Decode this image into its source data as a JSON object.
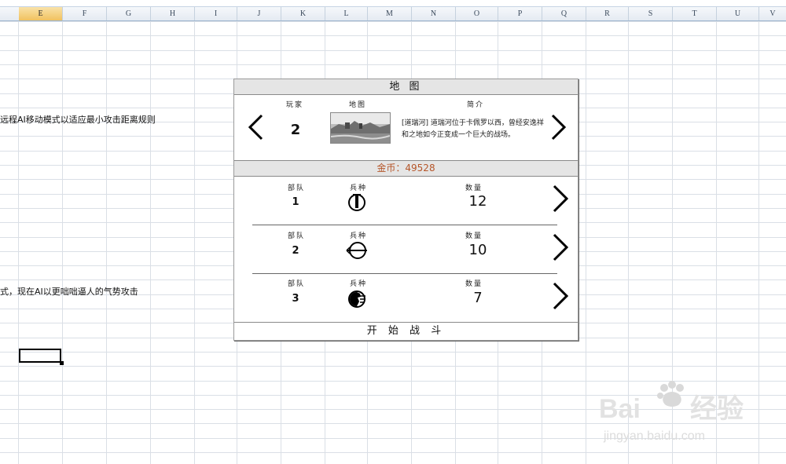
{
  "sheet": {
    "columns": [
      "E",
      "F",
      "G",
      "H",
      "I",
      "J",
      "K",
      "L",
      "M",
      "N",
      "O",
      "P",
      "Q",
      "R",
      "S",
      "T",
      "U",
      "V"
    ],
    "selected_column": "E",
    "cells": [
      {
        "id": "row-a",
        "text": "远程AI移动模式以适应最小攻击距离规则"
      },
      {
        "id": "row-b",
        "text": "式，现在AI以更咄咄逼人的气势攻击"
      }
    ]
  },
  "panel": {
    "title": "地 图",
    "header": {
      "player_label": "玩家",
      "map_label": "地图",
      "intro_label": "简介",
      "player_value": "2",
      "intro_text": "[道瑞河] 道瑞河位于卡佩罗以西，曾经安逸祥和之地如今正变成一个巨大的战场。"
    },
    "gold_text": "金币：49528",
    "units": [
      {
        "troop_label": "部队",
        "type_label": "兵种",
        "qty_label": "数量",
        "troop": "1",
        "unit_icon": "sword-unit-icon",
        "qty": "12"
      },
      {
        "troop_label": "部队",
        "type_label": "兵种",
        "qty_label": "数量",
        "troop": "2",
        "unit_icon": "archer-unit-icon",
        "qty": "10"
      },
      {
        "troop_label": "部队",
        "type_label": "兵种",
        "qty_label": "数量",
        "troop": "3",
        "unit_icon": "cavalry-unit-icon",
        "qty": "7"
      }
    ],
    "start_label": "开 始 战 斗"
  },
  "watermark": {
    "logo_text": "Baidu经验",
    "url_text": "jingyan.baidu.com"
  },
  "colors": {
    "gold": "#b5562a",
    "bar": "#e5e5e5",
    "grid": "#dadfe6"
  }
}
